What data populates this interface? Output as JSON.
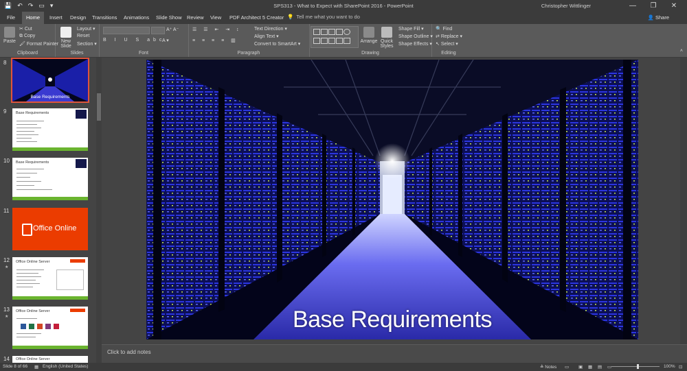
{
  "window": {
    "title": "SPS313 - What to Expect with SharePoint 2016 - PowerPoint",
    "user": "Christopher Wittlinger",
    "minimize": "—",
    "restore": "❐",
    "close": "✕"
  },
  "ribbon_tabs": [
    {
      "label": "File"
    },
    {
      "label": "Home"
    },
    {
      "label": "Insert"
    },
    {
      "label": "Design"
    },
    {
      "label": "Transitions"
    },
    {
      "label": "Animations"
    },
    {
      "label": "Slide Show"
    },
    {
      "label": "Review"
    },
    {
      "label": "View"
    },
    {
      "label": "PDF Architect 5 Creator"
    }
  ],
  "tell_me": "Tell me what you want to do",
  "share": "Share",
  "ribbon": {
    "clipboard": {
      "label": "Clipboard",
      "paste": "Paste",
      "cut": "Cut",
      "copy": "Copy",
      "format_painter": "Format Painter"
    },
    "slides": {
      "label": "Slides",
      "new_slide": "New Slide",
      "layout": "Layout",
      "reset": "Reset",
      "section": "Section"
    },
    "font": {
      "label": "Font"
    },
    "paragraph": {
      "label": "Paragraph",
      "text_direction": "Text Direction",
      "align_text": "Align Text",
      "convert_smartart": "Convert to SmartArt"
    },
    "drawing": {
      "label": "Drawing",
      "arrange": "Arrange",
      "quick_styles": "Quick Styles",
      "shape_fill": "Shape Fill",
      "shape_outline": "Shape Outline",
      "shape_effects": "Shape Effects"
    },
    "editing": {
      "label": "Editing",
      "find": "Find",
      "replace": "Replace",
      "select": "Select"
    }
  },
  "thumbnails": [
    {
      "num": "8",
      "title": "Base Requirements"
    },
    {
      "num": "9",
      "title": "Base Requirements"
    },
    {
      "num": "10",
      "title": "Base Requirements"
    },
    {
      "num": "11",
      "title": "Office Online"
    },
    {
      "num": "12",
      "title": "Office Online Server"
    },
    {
      "num": "13",
      "title": "Office Online Server"
    },
    {
      "num": "14",
      "title": "Office Online Server"
    }
  ],
  "slide": {
    "title": "Base Requirements"
  },
  "notes_placeholder": "Click to add notes",
  "status": {
    "slide_count": "Slide 8 of 66",
    "language": "English (United States)",
    "notes": "Notes",
    "zoom": "100%"
  },
  "colors": {
    "accent": "#e0553b",
    "office_orange": "#eb3c00",
    "server_blue": "#3040ff"
  }
}
